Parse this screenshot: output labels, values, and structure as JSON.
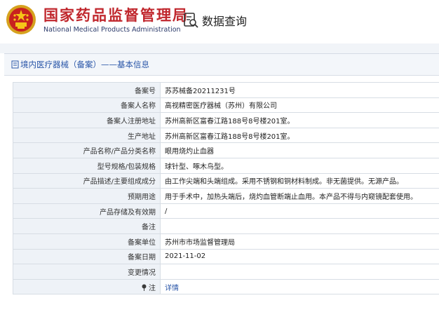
{
  "header": {
    "brand_cn": "国家药品监督管理局",
    "brand_en": "National Medical Products Administration",
    "query_label": "数据查询",
    "brand_color": "#c0272d"
  },
  "panel": {
    "title": "境内医疗器械（备案）——基本信息"
  },
  "rows": [
    {
      "label": "备案号",
      "value": "苏苏械备20211231号"
    },
    {
      "label": "备案人名称",
      "value": "高视精密医疗器械（苏州）有限公司"
    },
    {
      "label": "备案人注册地址",
      "value": "苏州高新区富春江路188号8号楼201室。"
    },
    {
      "label": "生产地址",
      "value": "苏州高新区富春江路188号8号楼201室。"
    },
    {
      "label": "产品名称/产品分类名称",
      "value": "眼用烧灼止血器"
    },
    {
      "label": "型号规格/包装规格",
      "value": "球针型、啄木鸟型。"
    },
    {
      "label": "产品描述/主要组成成分",
      "value": "由工作尖端和头端组成。采用不锈钢和铜材料制成。非无菌提供。无源产品。"
    },
    {
      "label": "预期用途",
      "value": "用于手术中，加热头端后，烧灼血管断端止血用。本产品不得与内窥镜配套使用。"
    },
    {
      "label": "产品存储及有效期",
      "value": "/"
    },
    {
      "label": "备注",
      "value": ""
    },
    {
      "label": "备案单位",
      "value": "苏州市市场监督管理局"
    },
    {
      "label": "备案日期",
      "value": "2021-11-02"
    },
    {
      "label": "变更情况",
      "value": ""
    }
  ],
  "note": {
    "label": "注",
    "link": "详情"
  }
}
